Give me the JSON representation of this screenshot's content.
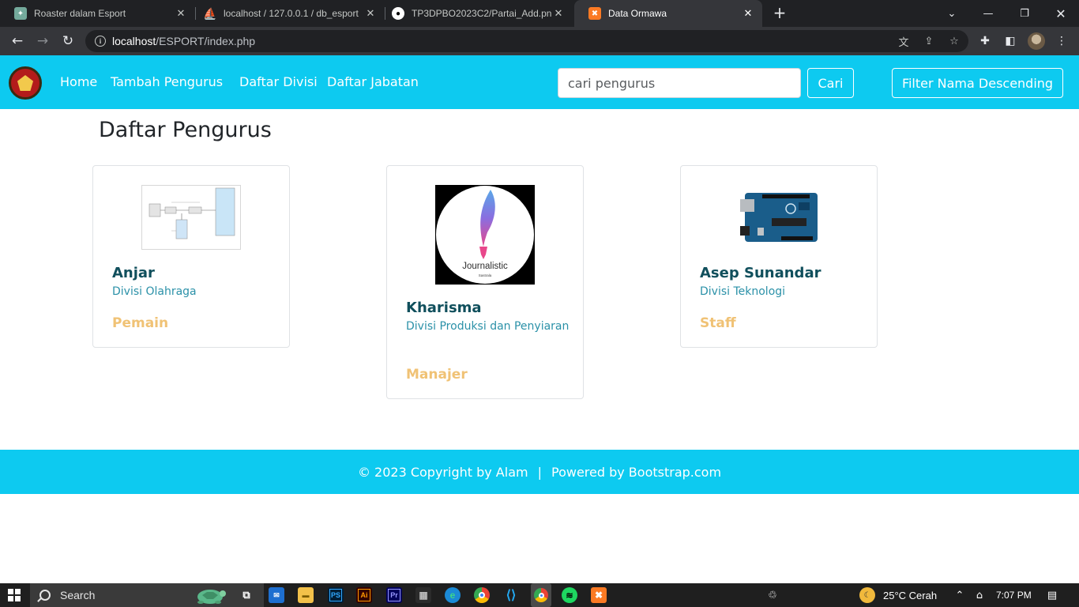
{
  "browser": {
    "tabs": [
      {
        "title": "Roaster dalam Esport",
        "icon": "chatgpt-icon",
        "active": false
      },
      {
        "title": "localhost / 127.0.0.1 / db_esport",
        "icon": "phpmyadmin-icon",
        "active": false
      },
      {
        "title": "TP3DPBO2023C2/Partai_Add.png",
        "icon": "github-icon",
        "active": false
      },
      {
        "title": "Data Ormawa",
        "icon": "xampp-icon",
        "active": true
      }
    ],
    "url_host": "localhost",
    "url_path": "/ESPORT/index.php"
  },
  "navbar": {
    "links": [
      "Home",
      "Tambah Pengurus",
      "Daftar Divisi",
      "Daftar Jabatan"
    ],
    "search_placeholder": "cari pengurus",
    "search_button": "Cari",
    "filter_button": "Filter Nama Descending",
    "accent_color": "#0dcaf0"
  },
  "main": {
    "title": "Daftar Pengurus",
    "cards": [
      {
        "name": "Anjar",
        "divisi": "Divisi Olahraga",
        "jabatan": "Pemain",
        "image": "diagram-thumbnail"
      },
      {
        "name": "Kharisma",
        "divisi": "Divisi Produksi dan Penyiaran",
        "jabatan": "Manajer",
        "image": "journalistic-logo",
        "image_text": "Journalistic",
        "image_subtext": "Sastrala"
      },
      {
        "name": "Asep Sunandar",
        "divisi": "Divisi Teknologi",
        "jabatan": "Staff",
        "image": "arduino-board"
      }
    ]
  },
  "footer": {
    "copyright": "© 2023 Copyright by Alam",
    "separator": "|",
    "powered": "Powered by Bootstrap.com"
  },
  "taskbar": {
    "search_label": "Search",
    "weather": "25°C  Cerah",
    "time": "7:07 PM",
    "apps": [
      {
        "label": "PS",
        "color": "#31a8ff",
        "bg": "#001e36"
      },
      {
        "label": "Ai",
        "color": "#ff9a00",
        "bg": "#330000"
      },
      {
        "label": "Pr",
        "color": "#9999ff",
        "bg": "#00005b"
      }
    ]
  }
}
